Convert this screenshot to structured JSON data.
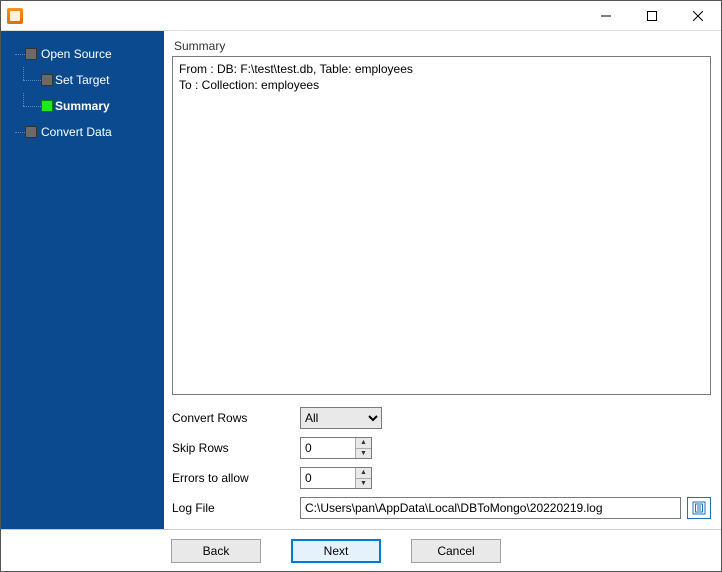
{
  "window": {
    "title": ""
  },
  "sidebar": {
    "steps": [
      {
        "label": "Open Source"
      },
      {
        "label": "Set Target"
      },
      {
        "label": "Summary"
      },
      {
        "label": "Convert Data"
      }
    ],
    "active_index": 2
  },
  "main": {
    "section_label": "Summary",
    "summary_lines": [
      "From : DB: F:\\test\\test.db, Table: employees",
      "To : Collection: employees"
    ],
    "form": {
      "convert_rows": {
        "label": "Convert Rows",
        "value": "All",
        "options": [
          "All"
        ]
      },
      "skip_rows": {
        "label": "Skip Rows",
        "value": "0"
      },
      "errors_allow": {
        "label": "Errors to allow",
        "value": "0"
      },
      "log_file": {
        "label": "Log File",
        "value": "C:\\Users\\pan\\AppData\\Local\\DBToMongo\\20220219.log"
      }
    }
  },
  "footer": {
    "back": "Back",
    "next": "Next",
    "cancel": "Cancel"
  }
}
